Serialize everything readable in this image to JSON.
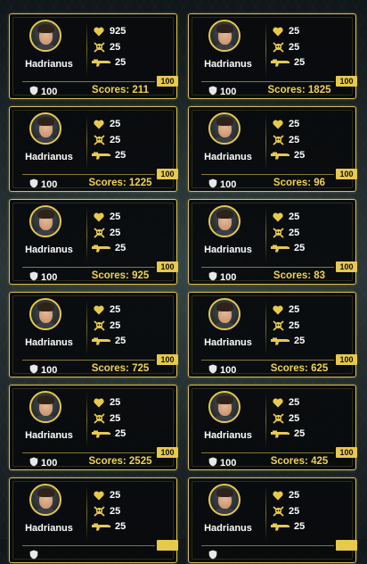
{
  "icons": {
    "hearts": "heart-icon",
    "kills": "skull-crossbones-icon",
    "ammo": "gun-icon",
    "shield": "shield-icon"
  },
  "colors": {
    "accent": "#e7c94d",
    "score_text": "#f0d34e",
    "card_bg": "#080b0d"
  },
  "cards": [
    {
      "name": "Hadrianus",
      "hearts": "925",
      "kills": "25",
      "ammo": "25",
      "shield": "100",
      "score": "Scores: 211",
      "badge": "100"
    },
    {
      "name": "Hadrianus",
      "hearts": "25",
      "kills": "25",
      "ammo": "25",
      "shield": "100",
      "score": "Scores: 1825",
      "badge": "100"
    },
    {
      "name": "Hadrianus",
      "hearts": "25",
      "kills": "25",
      "ammo": "25",
      "shield": "100",
      "score": "Scores: 1225",
      "badge": "100"
    },
    {
      "name": "Hadrianus",
      "hearts": "25",
      "kills": "25",
      "ammo": "25",
      "shield": "100",
      "score": "Scores: 96",
      "badge": "100"
    },
    {
      "name": "Hadrianus",
      "hearts": "25",
      "kills": "25",
      "ammo": "25",
      "shield": "100",
      "score": "Scores: 925",
      "badge": "100"
    },
    {
      "name": "Hadrianus",
      "hearts": "25",
      "kills": "25",
      "ammo": "25",
      "shield": "100",
      "score": "Scores: 83",
      "badge": "100"
    },
    {
      "name": "Hadrianus",
      "hearts": "25",
      "kills": "25",
      "ammo": "25",
      "shield": "100",
      "score": "Scores: 725",
      "badge": "100"
    },
    {
      "name": "Hadrianus",
      "hearts": "25",
      "kills": "25",
      "ammo": "25",
      "shield": "100",
      "score": "Scores: 625",
      "badge": "100"
    },
    {
      "name": "Hadrianus",
      "hearts": "25",
      "kills": "25",
      "ammo": "25",
      "shield": "100",
      "score": "Scores: 2525",
      "badge": "100"
    },
    {
      "name": "Hadrianus",
      "hearts": "25",
      "kills": "25",
      "ammo": "25",
      "shield": "100",
      "score": "Scores: 425",
      "badge": "100"
    },
    {
      "name": "Hadrianus",
      "hearts": "25",
      "kills": "25",
      "ammo": "25",
      "shield": "",
      "score": "",
      "badge": ""
    },
    {
      "name": "Hadrianus",
      "hearts": "25",
      "kills": "25",
      "ammo": "25",
      "shield": "",
      "score": "",
      "badge": ""
    }
  ]
}
